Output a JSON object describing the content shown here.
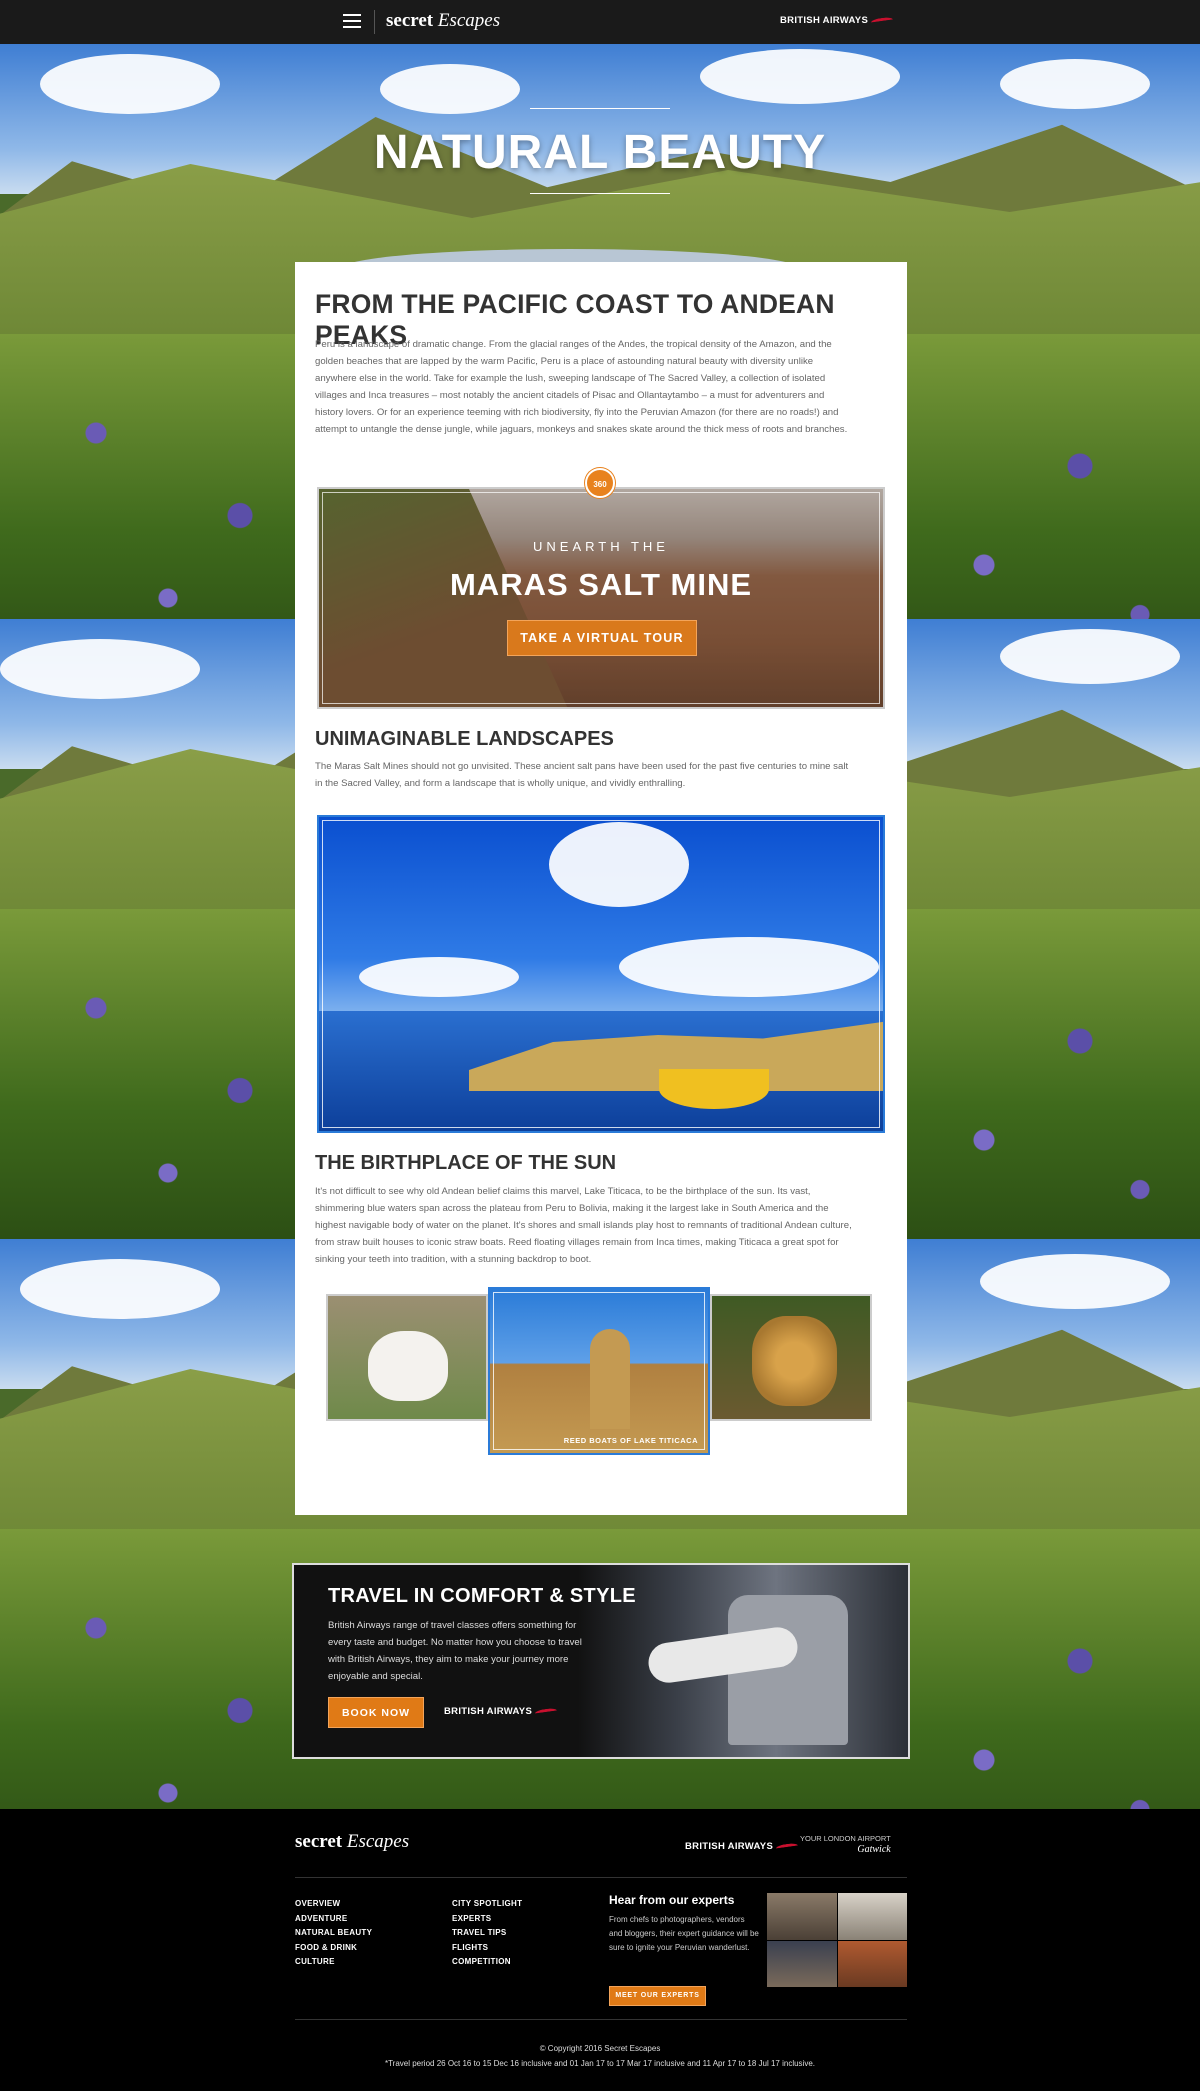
{
  "nav": {
    "brand_script": "secret",
    "brand_italic": "Escapes",
    "partner": "BRITISH AIRWAYS"
  },
  "hero": {
    "title": "NATURAL BEAUTY"
  },
  "intro": {
    "heading": "FROM THE PACIFIC COAST TO ANDEAN PEAKS",
    "body": "Peru is a landscape of dramatic change. From the glacial ranges of the Andes, the tropical density of the Amazon, and the golden beaches that are lapped by the warm Pacific, Peru is a place of astounding natural beauty with diversity unlike anywhere else in the world. Take for example the lush, sweeping landscape of The Sacred Valley, a collection of isolated villages and Inca treasures – most notably the ancient citadels of Pisac and Ollantaytambo – a must for adventurers and history lovers. Or for an experience teeming with rich biodiversity, fly into the Peruvian Amazon (for there are no roads!) and attempt to untangle the dense jungle, while jaguars, monkeys and snakes skate around the thick mess of roots and branches."
  },
  "tour": {
    "badge": "360",
    "subtitle": "UNEARTH THE",
    "title": "MARAS SALT MINE",
    "button": "TAKE A VIRTUAL TOUR"
  },
  "landscapes": {
    "heading": "UNIMAGINABLE LANDSCAPES",
    "body": "The Maras Salt Mines should not go unvisited. These ancient salt pans have been used for the past five centuries to mine salt in the Sacred Valley, and form a landscape that is wholly unique, and vividly enthralling."
  },
  "sun": {
    "heading": "THE BIRTHPLACE OF THE SUN",
    "body": "It's not difficult to see why old Andean belief claims this marvel, Lake Titicaca, to be the birthplace of the sun. Its vast, shimmering blue waters span across the plateau from Peru to Bolivia, making it the largest lake in South America and the highest navigable body of water on the planet. It's shores and small islands play host to remnants of traditional Andean culture, from straw built houses to iconic straw boats. Reed floating villages remain from Inca times, making Titicaca a great spot for sinking your teeth into tradition, with a stunning backdrop to boot."
  },
  "gallery": {
    "caption": "REED BOATS OF LAKE TITICACA"
  },
  "travel": {
    "heading": "TRAVEL IN COMFORT & STYLE",
    "body": "British Airways range of travel classes offers something for every taste and budget. No matter how you choose to travel with British Airways, they aim to make your journey more enjoyable and special.",
    "button": "BOOK NOW",
    "partner": "BRITISH AIRWAYS"
  },
  "footer": {
    "brand_script": "secret",
    "brand_italic": "Escapes",
    "partner": "BRITISH AIRWAYS",
    "gatwick_tag": "YOUR LONDON AIRPORT",
    "gatwick_name": "Gatwick",
    "col1": [
      "OVERVIEW",
      "ADVENTURE",
      "NATURAL BEAUTY",
      "FOOD & DRINK",
      "CULTURE"
    ],
    "col2": [
      "CITY SPOTLIGHT",
      "EXPERTS",
      "TRAVEL TIPS",
      "FLIGHTS",
      "COMPETITION"
    ],
    "experts_heading": "Hear from our experts",
    "experts_body": "From chefs to photographers, vendors and bloggers, their expert guidance will be sure to ignite your Peruvian wanderlust.",
    "experts_button": "MEET OUR EXPERTS",
    "copyright": "© Copyright 2016 Secret Escapes",
    "terms": "*Travel period 26 Oct 16 to 15 Dec 16 inclusive and 01 Jan 17 to 17 Mar 17 inclusive and 11 Apr 17 to 18 Jul 17 inclusive."
  },
  "colors": {
    "accent_orange": "#e07a16",
    "ba_red": "#c8102e",
    "nav_bg": "#1a1a1a",
    "footer_bg": "#000000"
  },
  "icons": [
    "menu-icon",
    "ba-swoosh-icon",
    "360-icon"
  ]
}
